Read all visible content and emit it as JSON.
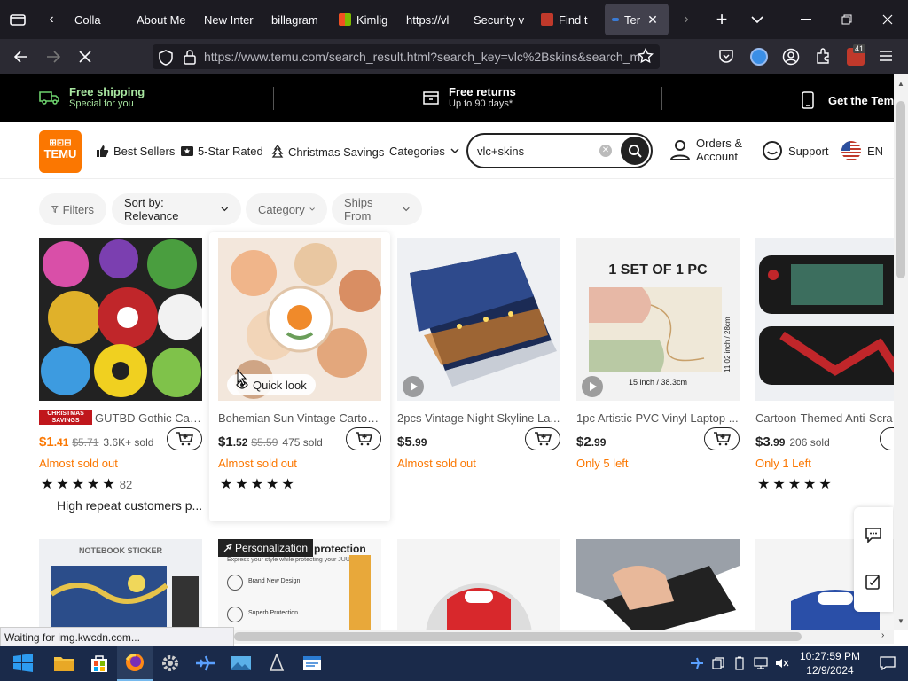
{
  "browser": {
    "tabs": [
      {
        "label": "Colla",
        "color": "#fbfbfe"
      },
      {
        "label": "About Me",
        "color": "#fbfbfe"
      },
      {
        "label": "New Inter",
        "color": "#fbfbfe"
      },
      {
        "label": "billagram",
        "color": "#fbfbfe"
      },
      {
        "label": "Kimlig",
        "color": "#fbfbfe"
      },
      {
        "label": "https://vl",
        "color": "#fbfbfe"
      },
      {
        "label": "Security v",
        "color": "#fbfbfe"
      },
      {
        "label": "Find t",
        "color": "#fbfbfe"
      },
      {
        "label": "Ter",
        "color": "#fbfbfe"
      }
    ],
    "url": "https://www.temu.com/search_result.html?search_key=vlc%2Bskins&search_m",
    "extension_badge": "41",
    "status_text": "Waiting for img.kwcdn.com..."
  },
  "promo": {
    "shipping_title": "Free shipping",
    "shipping_sub": "Special for you",
    "returns_title": "Free returns",
    "returns_sub": "Up to 90 days*",
    "app_text": "Get the Temu"
  },
  "header": {
    "logo_line1": "⊞⊡⊟",
    "logo_line2": "TEMU",
    "nav": {
      "best_sellers": "Best Sellers",
      "five_star": "5-Star Rated",
      "christmas": "Christmas Savings",
      "categories": "Categories"
    },
    "search_value": "vlc+skins",
    "orders_line1": "Orders &",
    "orders_line2": "Account",
    "support": "Support",
    "language": "EN"
  },
  "filters": {
    "filters": "Filters",
    "sort": "Sort by: Relevance",
    "category": "Category",
    "ships_from": "Ships From"
  },
  "products": [
    {
      "badge_line1": "CHRISTMAS",
      "badge_line2": "SAVINGS",
      "title": "GUTBD Gothic Cart...",
      "price_int": "$1",
      "price_dec": ".41",
      "old": "$5.71",
      "sold": "3.6K+ sold",
      "status": "Almost sold out",
      "rating_count": "82",
      "note": "High repeat customers p..."
    },
    {
      "title": "Bohemian Sun Vintage Cartoo...",
      "price_int": "$1",
      "price_dec": ".52",
      "old": "$5.59",
      "sold": "475 sold",
      "status": "Almost sold out",
      "quick_look": "Quick look"
    },
    {
      "title": "2pcs Vintage Night Skyline La...",
      "price_int": "$5",
      "price_dec": ".99",
      "status": "Almost sold out"
    },
    {
      "title": "1pc Artistic PVC Vinyl Laptop ...",
      "price_int": "$2",
      "price_dec": ".99",
      "status": "Only 5 left",
      "img_title": "1 SET OF 1 PC",
      "img_dim1": "11.02 inch / 28cm",
      "img_dim2": "15 inch / 38.3cm"
    },
    {
      "title": "Cartoon-Themed Anti-Scra",
      "price_int": "$3",
      "price_dec": ".99",
      "sold": "206 sold",
      "status": "Only 1 Left"
    }
  ],
  "row2": {
    "notebook_label": "NOTEBOOK STICKER",
    "personalization": "Personalization",
    "protection": "protection",
    "protection_sub": "Express your style while protecting your JUUL",
    "feature1": "Brand New Design",
    "feature2": "Superb Protection"
  },
  "taskbar": {
    "time": "10:27:59 PM",
    "date": "12/9/2024"
  }
}
